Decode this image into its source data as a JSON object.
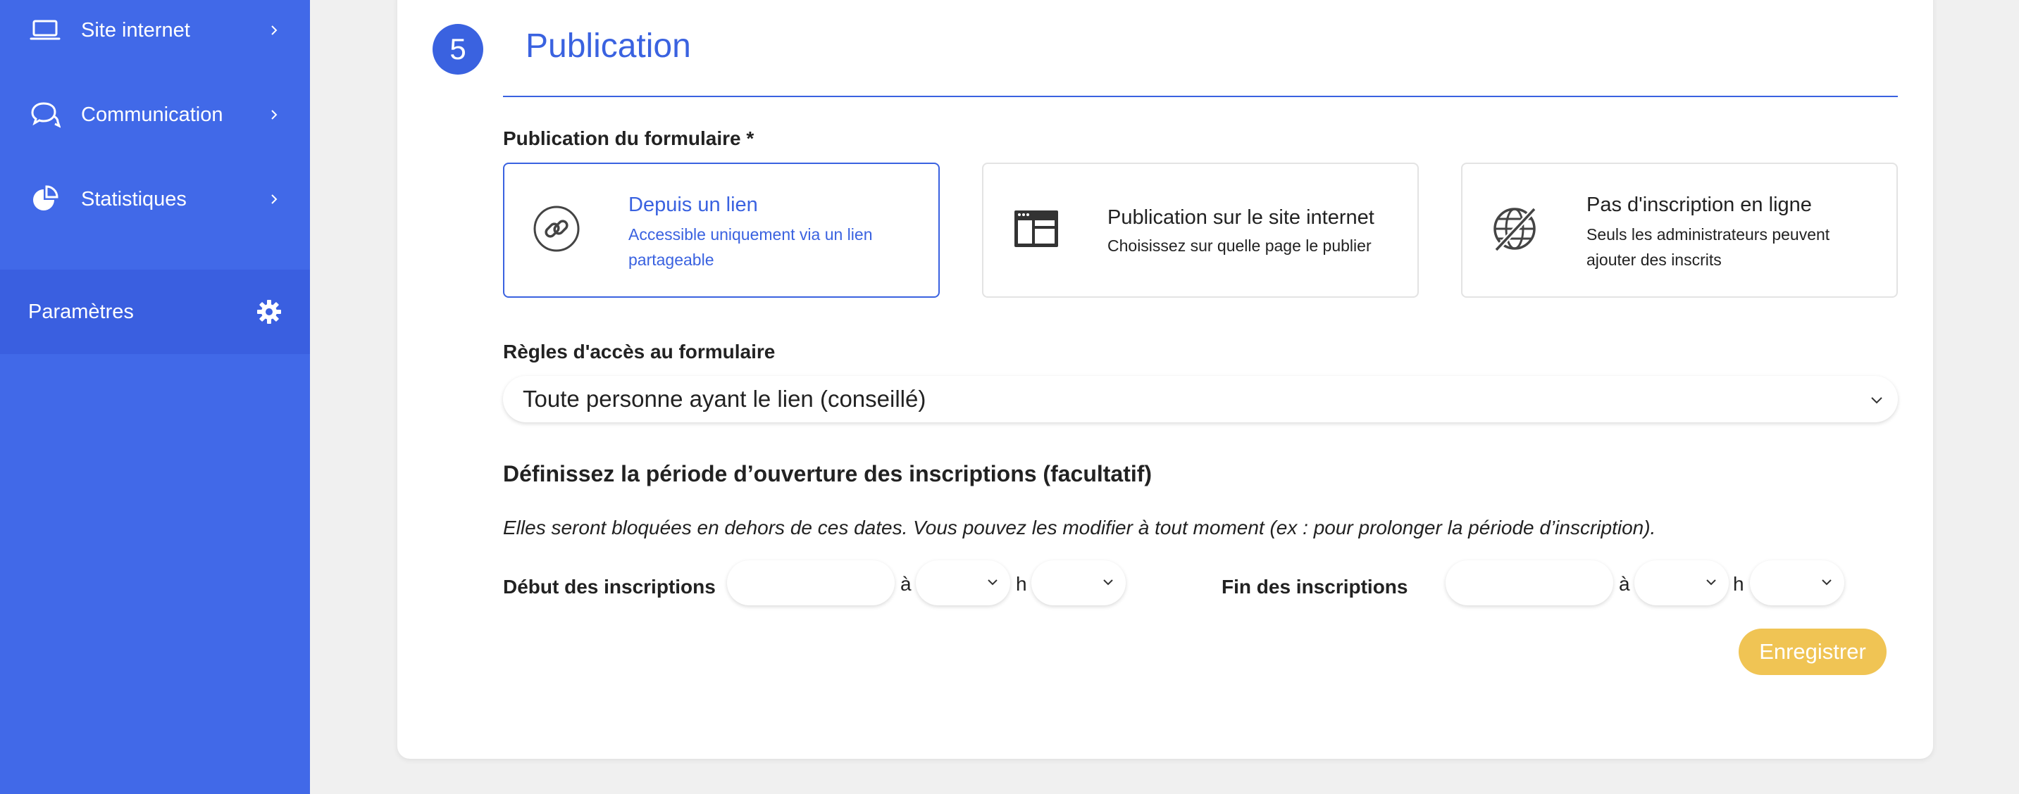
{
  "sidebar": {
    "items": [
      {
        "label": "Site internet",
        "icon": "laptop-icon"
      },
      {
        "label": "Communication",
        "icon": "chat-bubbles-icon"
      },
      {
        "label": "Statistiques",
        "icon": "pie-chart-icon"
      }
    ],
    "active": {
      "label": "Paramètres",
      "icon": "gear-icon"
    },
    "color": "#4169e8"
  },
  "section": {
    "step": "5",
    "title": "Publication",
    "accent": "#3a62e0"
  },
  "publication": {
    "label": "Publication du formulaire *",
    "options": [
      {
        "title": "Depuis un lien",
        "subtitle": "Accessible uniquement via un lien partageable",
        "icon": "link-icon",
        "selected": true
      },
      {
        "title": "Publication sur le site internet",
        "subtitle": "Choisissez sur quelle page le publier",
        "icon": "webpage-layout-icon",
        "selected": false
      },
      {
        "title": "Pas d'inscription en ligne",
        "subtitle": "Seuls les administrateurs peuvent ajouter des inscrits",
        "icon": "globe-crossed-icon",
        "selected": false
      }
    ]
  },
  "access": {
    "label": "Règles d'accès au formulaire",
    "selected": "Toute personne ayant le lien (conseillé)"
  },
  "period": {
    "heading": "Définissez la période d’ouverture des inscriptions (facultatif)",
    "note": "Elles seront bloquées en dehors de ces dates. Vous pouvez les modifier à tout moment (ex : pour prolonger la période d’inscription).",
    "start_label": "Début des inscriptions",
    "end_label": "Fin des inscriptions",
    "at": "à",
    "hour": "h",
    "start_date": "",
    "end_date": ""
  },
  "save_label": "Enregistrer",
  "save_color": "#f0c454"
}
